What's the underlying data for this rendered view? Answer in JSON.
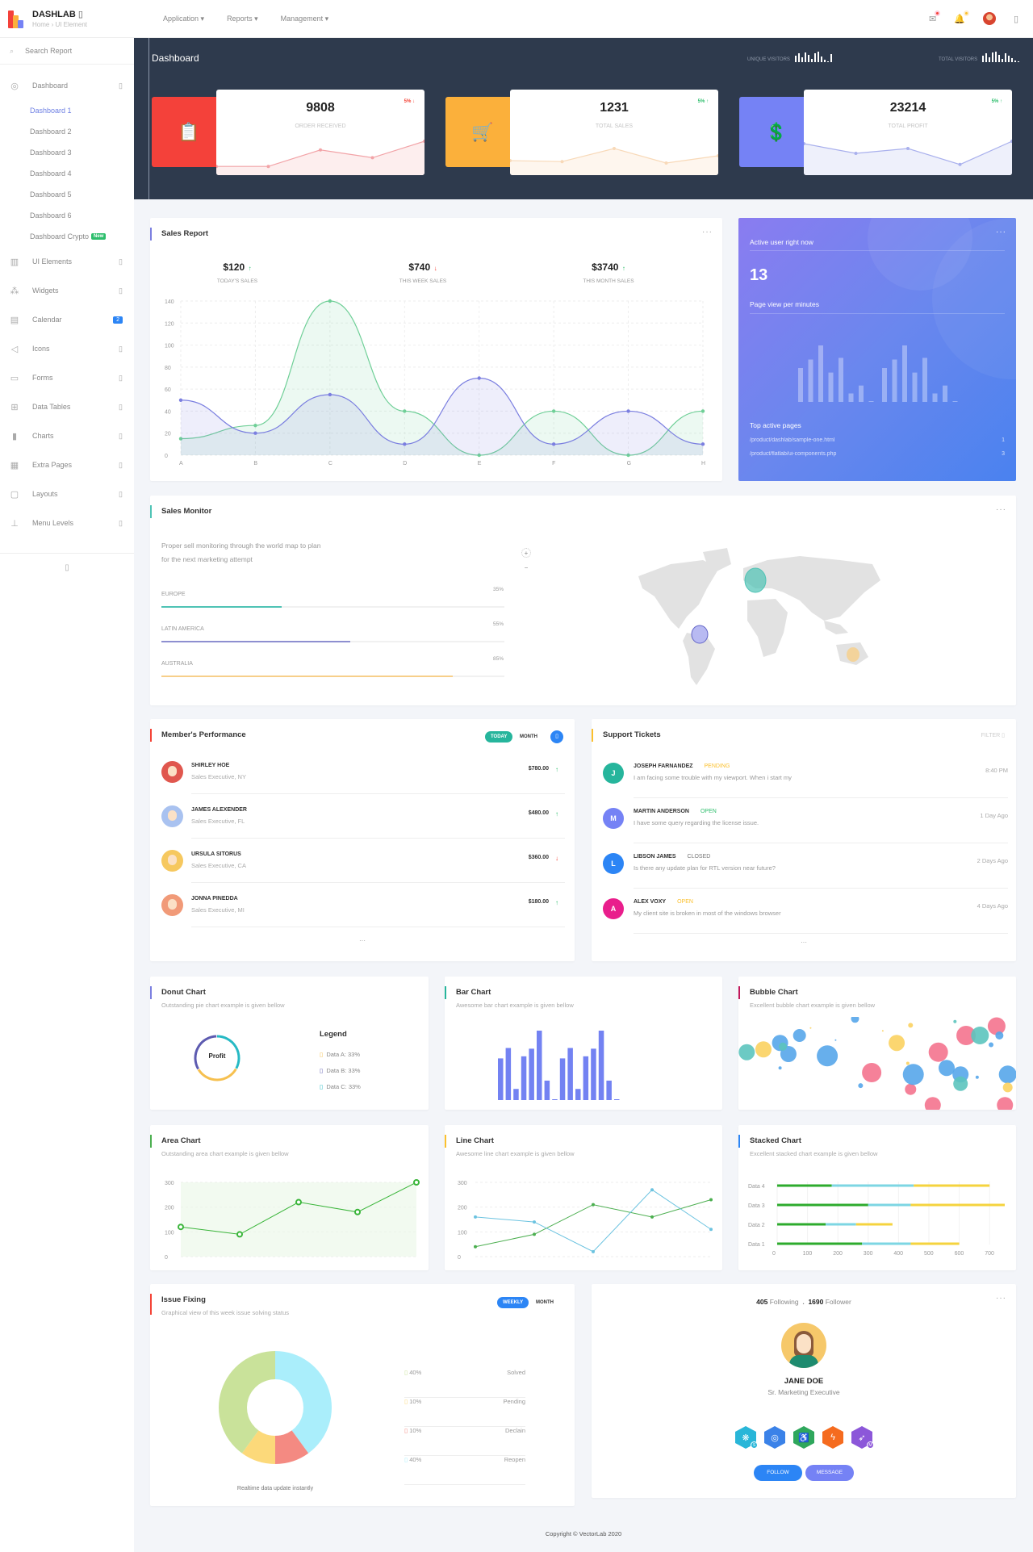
{
  "topbar": {
    "brand": "DASHLAB",
    "breadcrumb": "Home › UI Element",
    "nav": [
      "Application",
      "Reports",
      "Management"
    ],
    "icons": [
      "chat-icon",
      "bell-icon",
      "avatar",
      "more-icon"
    ]
  },
  "sidebar": {
    "search": "Search Report",
    "dashboard": "Dashboard",
    "subs": [
      "Dashboard 1",
      "Dashboard 2",
      "Dashboard 3",
      "Dashboard 4",
      "Dashboard 5",
      "Dashboard 6",
      "Dashboard Crypto"
    ],
    "new_badge": "New",
    "items": [
      {
        "label": "UI Elements",
        "icon": "▥"
      },
      {
        "label": "Widgets",
        "icon": "⁂"
      },
      {
        "label": "Calendar",
        "icon": "▤",
        "badge": "2"
      },
      {
        "label": "Icons",
        "icon": "◁"
      },
      {
        "label": "Forms",
        "icon": "▭"
      },
      {
        "label": "Data Tables",
        "icon": "⊞"
      },
      {
        "label": "Charts",
        "icon": "▮"
      },
      {
        "label": "Extra Pages",
        "icon": "▦"
      },
      {
        "label": "Layouts",
        "icon": "▢"
      },
      {
        "label": "Menu Levels",
        "icon": "⊥"
      }
    ]
  },
  "hero": {
    "title": "Dashboard",
    "unique_visitors": "UNIQUE VISITORS",
    "total_visitors": "TOTAL VISITORS",
    "unique_bars": [
      8,
      11,
      6,
      12,
      9,
      4,
      11,
      13,
      7,
      3,
      1,
      10
    ],
    "total_bars": [
      8,
      11,
      6,
      12,
      13,
      9,
      4,
      11,
      8,
      5,
      2,
      1
    ]
  },
  "stats": [
    {
      "value": "9808",
      "label": "ORDER RECEIVED",
      "pct": "5% ↓",
      "pct_color": "#f44336",
      "color": "#f4413a",
      "line": "#f2a3a7",
      "fill": "#fdeeee",
      "points": [
        18,
        18,
        52,
        36,
        70
      ],
      "icon": "clipboard-icon"
    },
    {
      "value": "1231",
      "label": "TOTAL SALES",
      "pct": "5% ↑",
      "pct_color": "#2dbe6c",
      "color": "#fbb03b",
      "line": "#f8d9b8",
      "fill": "#fef6ee",
      "points": [
        30,
        28,
        55,
        25,
        40
      ],
      "icon": "cart-icon"
    },
    {
      "value": "23214",
      "label": "TOTAL PROFIT",
      "pct": "5% ↑",
      "pct_color": "#2dbe6c",
      "color": "#7582f5",
      "line": "#a9b0ed",
      "fill": "#eef0fb",
      "points": [
        65,
        45,
        55,
        22,
        70
      ],
      "icon": "money-hand-icon"
    }
  ],
  "sales_report": {
    "title": "Sales Report",
    "summary": [
      {
        "value": "$120",
        "arrow": "↑",
        "color": "#2dbe6c",
        "label": "TODAY'S SALES"
      },
      {
        "value": "$740",
        "arrow": "↓",
        "color": "#f44336",
        "label": "THIS WEEK SALES"
      },
      {
        "value": "$3740",
        "arrow": "↑",
        "color": "#2dbe6c",
        "label": "THIS MONTH SALES"
      }
    ]
  },
  "active_users": {
    "title": "Active user right now",
    "count": "13",
    "subtitle": "Page view per minutes",
    "bars": [
      60,
      75,
      100,
      52,
      78,
      15,
      29,
      1,
      60,
      75,
      100,
      52,
      78,
      15,
      29,
      1
    ],
    "top_pages_title": "Top active pages",
    "pages": [
      {
        "path": "/product/dashlab/sample-one.html",
        "count": "1"
      },
      {
        "path": "/product/flatlab/ui-components.php",
        "count": "3"
      }
    ]
  },
  "sales_monitor": {
    "title": "Sales Monitor",
    "description_1": "Proper sell monitoring through the world map to plan",
    "description_2": "for the next marketing attempt",
    "zoom_in": "+",
    "zoom_out": "−",
    "regions": [
      {
        "name": "EUROPE",
        "pct": "35%",
        "value": 35,
        "color": "#4fc3b5"
      },
      {
        "name": "LATIN AMERICA",
        "pct": "55%",
        "value": 55,
        "color": "#8e8fd0"
      },
      {
        "name": "AUSTRALIA",
        "pct": "85%",
        "value": 85,
        "color": "#f7cf8a"
      }
    ]
  },
  "members": {
    "title": "Member's Performance",
    "tab_today": "TODAY",
    "tab_month": "MONTH",
    "rows": [
      {
        "name": "SHIRLEY HOE",
        "role": "Sales Executive, NY",
        "amount": "$780.00",
        "arrow": "↑",
        "arrow_color": "#2dbe6c",
        "av": "#e0574e"
      },
      {
        "name": "JAMES ALEXENDER",
        "role": "Sales Executive, FL",
        "amount": "$480.00",
        "arrow": "↑",
        "arrow_color": "#2dbe6c",
        "av": "#a9c2f0"
      },
      {
        "name": "URSULA SITORUS",
        "role": "Sales Executive, CA",
        "amount": "$360.00",
        "arrow": "↓",
        "arrow_color": "#f44336",
        "av": "#f6c85f"
      },
      {
        "name": "JONNA PINEDDA",
        "role": "Sales Executive, MI",
        "amount": "$180.00",
        "arrow": "↑",
        "arrow_color": "#2dbe6c",
        "av": "#f19a78"
      }
    ],
    "more": "···"
  },
  "tickets": {
    "title": "Support Tickets",
    "filter": "FILTER",
    "rows": [
      {
        "initial": "J",
        "name": "JOSEPH FARNANDEZ",
        "status": "PENDING",
        "status_color": "#fbc02d",
        "msg": "I am facing some trouble with my viewport. When i start my",
        "time": "8:40 PM",
        "av": "#26b59c"
      },
      {
        "initial": "M",
        "name": "MARTIN ANDERSON",
        "status": "OPEN",
        "status_color": "#2dbe6c",
        "msg": "I have some query regarding the license issue.",
        "time": "1 Day Ago",
        "av": "#7582f5"
      },
      {
        "initial": "L",
        "name": "LIBSON JAMES",
        "status": "CLOSED",
        "status_color": "#777",
        "msg": "Is there any update plan for RTL version near future?",
        "time": "2 Days Ago",
        "av": "#2c85f5"
      },
      {
        "initial": "A",
        "name": "ALEX VOXY",
        "status": "OPEN",
        "status_color": "#fbc02d",
        "msg": "My client site is broken in most of the windows browser",
        "time": "4 Days Ago",
        "av": "#e91e8c"
      }
    ],
    "more": "···"
  },
  "donut": {
    "title": "Donut Chart",
    "subtitle": "Outstanding pie chart example is given bellow",
    "center": "Profit",
    "legend_title": "Legend",
    "legend": [
      {
        "label": "Data A: 33%",
        "color": "#f6c04f"
      },
      {
        "label": "Data B: 33%",
        "color": "#5d5bb0"
      },
      {
        "label": "Data C: 33%",
        "color": "#26b9c4"
      }
    ]
  },
  "bar": {
    "title": "Bar Chart",
    "subtitle": "Awesome bar chart example is given bellow"
  },
  "bubble": {
    "title": "Bubble Chart",
    "subtitle": "Excellent bubble chart example is given bellow"
  },
  "area": {
    "title": "Area Chart",
    "subtitle": "Outstanding area chart example is given bellow"
  },
  "line": {
    "title": "Line Chart",
    "subtitle": "Awesome line chart example is given bellow"
  },
  "stacked": {
    "title": "Stacked Chart",
    "subtitle": "Excellent stacked chart example is given bellow"
  },
  "issue": {
    "title": "Issue Fixing",
    "subtitle": "Graphical view of this week issue solving status",
    "tab_weekly": "WEEKLY",
    "tab_month": "MONTH",
    "caption": "Realtime data update instantly",
    "rows": [
      {
        "pct": "40%",
        "label": "Solved",
        "color": "#c9e29a"
      },
      {
        "pct": "10%",
        "label": "Pending",
        "color": "#fcd97a"
      },
      {
        "pct": "10%",
        "label": "Declain",
        "color": "#f48a82"
      },
      {
        "pct": "40%",
        "label": "Reopen",
        "color": "#aaeefb"
      }
    ]
  },
  "profile": {
    "following_count": "405",
    "following_label": "Following",
    "follower_count": "1690",
    "follower_label": "Follower",
    "name": "JANE DOE",
    "role": "Sr. Marketing Executive",
    "badges": [
      {
        "icon": "paw-icon",
        "glyph": "❋",
        "color": "#29b6d8",
        "mark": "S"
      },
      {
        "icon": "target-icon",
        "glyph": "◎",
        "color": "#3b82e8",
        "mark": ""
      },
      {
        "icon": "accessibility-icon",
        "glyph": "♿",
        "color": "#2fa75c",
        "mark": ""
      },
      {
        "icon": "bolt-icon",
        "glyph": "ϟ",
        "color": "#f56b1f",
        "mark": ""
      },
      {
        "icon": "rocket-icon",
        "glyph": "➶",
        "color": "#8c57d9",
        "mark": "M"
      }
    ],
    "follow": "FOLLOW",
    "message": "MESSAGE"
  },
  "footer": "Copyright © VectorLab 2020",
  "chart_data": [
    {
      "type": "area",
      "title": "Sales Report",
      "categories": [
        "A",
        "B",
        "C",
        "D",
        "E",
        "F",
        "G",
        "H"
      ],
      "ylim": [
        0,
        140
      ],
      "yticks": [
        0,
        20,
        40,
        60,
        80,
        100,
        120,
        140
      ],
      "grid": true,
      "series": [
        {
          "name": "Series 1",
          "color": "#6fcf97",
          "values": [
            15,
            27,
            140,
            40,
            0,
            40,
            0,
            40
          ]
        },
        {
          "name": "Series 2",
          "color": "#7b7fe0",
          "values": [
            50,
            20,
            55,
            10,
            70,
            10,
            40,
            10
          ]
        }
      ]
    },
    {
      "type": "bar",
      "title": "Bar Chart",
      "values": [
        60,
        75,
        16,
        63,
        74,
        100,
        28,
        1,
        60,
        75,
        16,
        63,
        74,
        100,
        28,
        1
      ],
      "ylim": [
        0,
        100
      ],
      "color": "#7382f2"
    },
    {
      "type": "pie",
      "title": "Donut Chart",
      "categories": [
        "Data A",
        "Data B",
        "Data C"
      ],
      "values": [
        33,
        33,
        33
      ],
      "colors": [
        "#f6c04f",
        "#5d5bb0",
        "#26b9c4"
      ]
    },
    {
      "type": "scatter",
      "title": "Bubble Chart",
      "series": [
        {
          "name": "red",
          "color": "#f4738e",
          "points": [
            [
              48,
              40,
              12
            ],
            [
              62,
              22,
              7
            ],
            [
              70,
              5,
              10
            ],
            [
              72,
              62,
              12
            ],
            [
              82,
              80,
              12
            ],
            [
              96,
              5,
              10
            ],
            [
              93,
              90,
              11
            ]
          ]
        },
        {
          "name": "blue",
          "color": "#56a6ea",
          "points": [
            [
              18,
              60,
              10
            ],
            [
              15,
              72,
              10
            ],
            [
              22,
              80,
              8
            ],
            [
              32,
              58,
              13
            ],
            [
              44,
              26,
              3
            ],
            [
              63,
              38,
              13
            ],
            [
              75,
              45,
              10
            ],
            [
              80,
              38,
              10
            ],
            [
              97,
              38,
              11
            ],
            [
              86,
              35,
              2
            ],
            [
              91,
              70,
              3
            ],
            [
              94,
              80,
              5
            ],
            [
              35,
              75,
              1
            ],
            [
              15,
              45,
              2
            ],
            [
              42,
              98,
              5
            ]
          ]
        },
        {
          "name": "teal",
          "color": "#5cc4be",
          "points": [
            [
              3,
              62,
              10
            ],
            [
              16,
              68,
              5
            ],
            [
              80,
              28,
              9
            ],
            [
              87,
              80,
              11
            ],
            [
              78,
              95,
              2
            ]
          ]
        },
        {
          "name": "yellow",
          "color": "#fbd160",
          "points": [
            [
              9,
              65,
              10
            ],
            [
              57,
              72,
              10
            ],
            [
              61,
              50,
              2
            ],
            [
              97,
              24,
              6
            ],
            [
              26,
              88,
              1
            ],
            [
              52,
              85,
              1
            ],
            [
              62,
              91,
              3
            ]
          ]
        }
      ]
    },
    {
      "type": "area",
      "title": "Area Chart",
      "x": [
        1,
        2,
        3,
        4,
        5
      ],
      "ylim": [
        0,
        300
      ],
      "yticks": [
        0,
        100,
        200,
        300
      ],
      "series": [
        {
          "name": "Series",
          "color": "#3ab53a",
          "values": [
            120,
            90,
            220,
            180,
            300
          ]
        }
      ]
    },
    {
      "type": "line",
      "title": "Line Chart",
      "x": [
        1,
        2,
        3,
        4,
        5,
        6
      ],
      "ylim": [
        0,
        300
      ],
      "yticks": [
        0,
        100,
        200,
        300
      ],
      "series": [
        {
          "name": "Green",
          "color": "#4caf50",
          "values": [
            40,
            90,
            210,
            160,
            230
          ]
        },
        {
          "name": "Blue",
          "color": "#6cc3e0",
          "values": [
            160,
            140,
            20,
            270,
            110
          ]
        }
      ]
    },
    {
      "type": "bar",
      "title": "Stacked Chart",
      "orientation": "horizontal",
      "categories": [
        "Data 1",
        "Data 2",
        "Data 3",
        "Data 4"
      ],
      "xlim": [
        0,
        750
      ],
      "xticks": [
        0,
        100,
        200,
        300,
        400,
        500,
        600,
        700
      ],
      "series": [
        {
          "name": "Green",
          "color": "#2dab2d",
          "values": [
            280,
            160,
            300,
            180
          ]
        },
        {
          "name": "Cyan",
          "color": "#7dd6e3",
          "values": [
            160,
            100,
            140,
            270
          ]
        },
        {
          "name": "Yellow",
          "color": "#f5d33e",
          "values": [
            160,
            120,
            310,
            250
          ]
        }
      ]
    },
    {
      "type": "pie",
      "title": "Issue Fixing",
      "categories": [
        "Solved",
        "Pending",
        "Declain",
        "Reopen"
      ],
      "values": [
        40,
        10,
        10,
        40
      ],
      "colors": [
        "#c9e29a",
        "#fcd97a",
        "#f48a82",
        "#aaeefb"
      ]
    }
  ]
}
